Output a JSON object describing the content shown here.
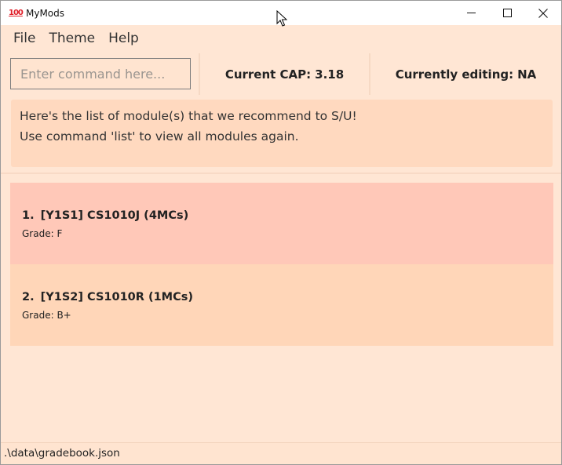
{
  "window": {
    "title": "MyMods",
    "icon": "hundred-points-icon",
    "icon_text": "100"
  },
  "menu": {
    "items": [
      "File",
      "Theme",
      "Help"
    ]
  },
  "command": {
    "placeholder": "Enter command here...",
    "value": ""
  },
  "stats": {
    "cap_label": "Current CAP:",
    "cap_value": "3.18",
    "editing_label": "Currently editing:",
    "editing_value": "NA"
  },
  "result": {
    "line1": "Here's the list of module(s) that we recommend to S/U!",
    "line2": "Use command 'list' to view all modules again."
  },
  "modules": [
    {
      "index": "1.",
      "title": "[Y1S1] CS1010J (4MCs)",
      "grade": "Grade: F",
      "color": "#ffc8b8"
    },
    {
      "index": "2.",
      "title": "[Y1S2] CS1010R (1MCs)",
      "grade": "Grade: B+",
      "color": "#ffd6b8"
    }
  ],
  "status": {
    "path": ".\\data\\gradebook.json"
  },
  "colors": {
    "background": "#ffe6d4",
    "result_box": "#ffd9bf",
    "failed_module": "#ffc8b8",
    "module": "#ffd6b8"
  }
}
